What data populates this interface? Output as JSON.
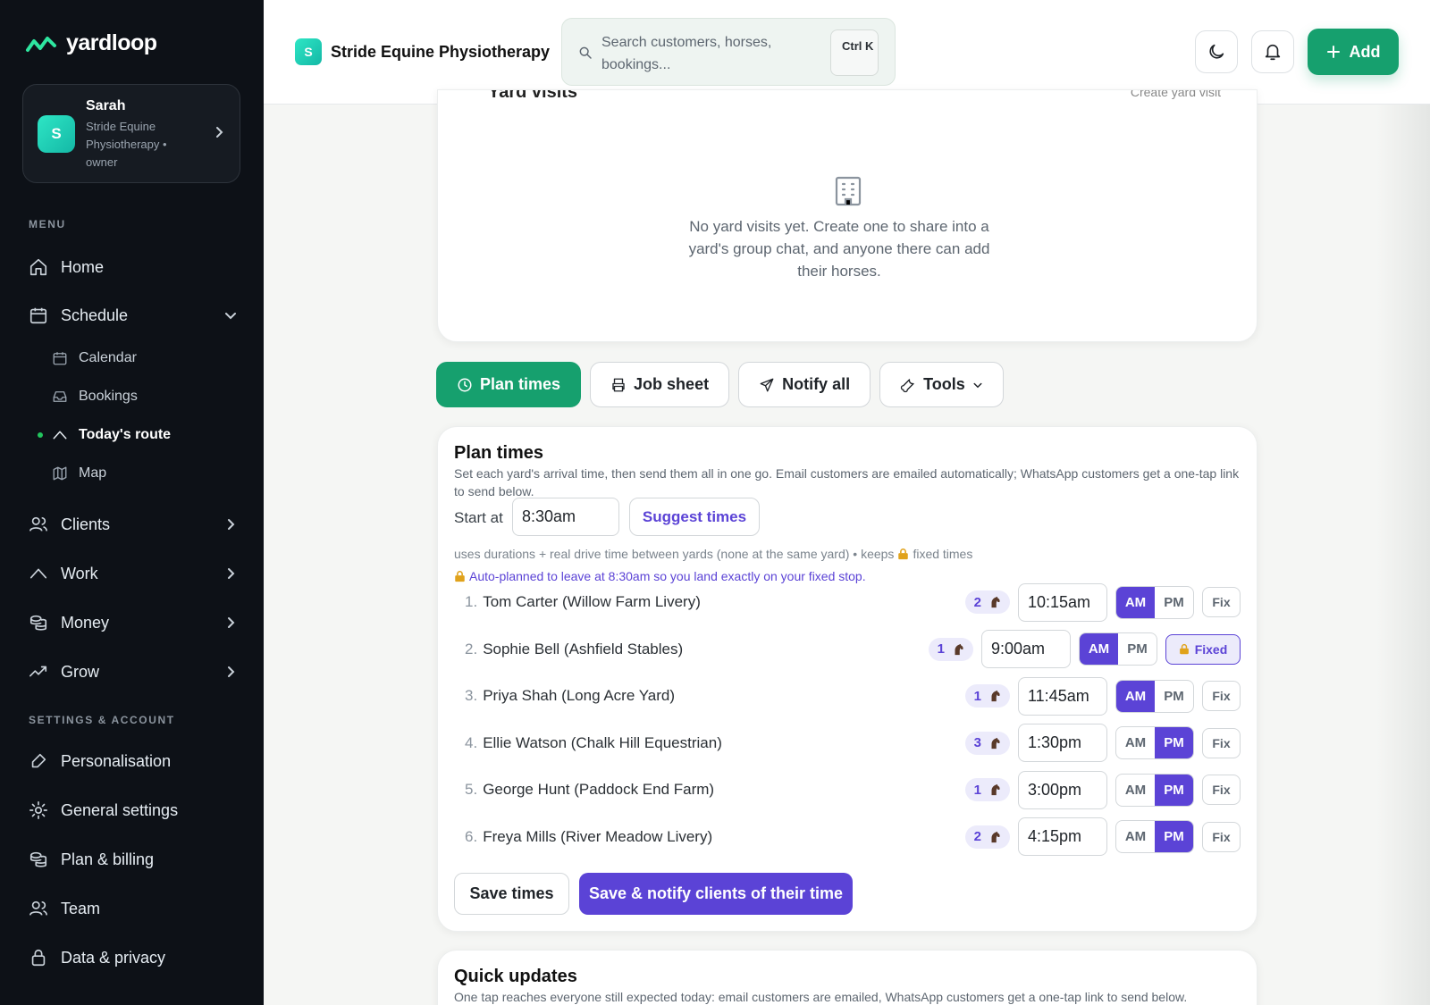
{
  "app": {
    "logo_text": "yardloop",
    "logo_icon": "yardloop-wave-icon"
  },
  "account": {
    "avatar_letter": "S",
    "name": "Sarah",
    "business": "Stride Equine Physiotherapy • owner"
  },
  "sidebar": {
    "menu_label": "MENU",
    "items": [
      {
        "label": "Home",
        "icon": "home-icon"
      },
      {
        "label": "Schedule",
        "icon": "calendar-icon"
      },
      {
        "label": "Clients",
        "icon": "users-icon"
      },
      {
        "label": "Work",
        "icon": "route-icon"
      },
      {
        "label": "Money",
        "icon": "coins-icon"
      },
      {
        "label": "Grow",
        "icon": "trend-icon"
      }
    ],
    "schedule_sub": [
      {
        "label": "Calendar",
        "icon": "calendar-icon"
      },
      {
        "label": "Bookings",
        "icon": "inbox-icon"
      },
      {
        "label": "Today's route",
        "icon": "route-icon",
        "active": true
      },
      {
        "label": "Map",
        "icon": "map-icon"
      }
    ],
    "settings_label": "SETTINGS & ACCOUNT",
    "settings_items": [
      {
        "label": "Personalisation",
        "icon": "brush-icon"
      },
      {
        "label": "General settings",
        "icon": "gear-icon"
      },
      {
        "label": "Plan & billing",
        "icon": "coins-icon"
      },
      {
        "label": "Team",
        "icon": "users-icon"
      },
      {
        "label": "Data & privacy",
        "icon": "lock-icon"
      }
    ]
  },
  "header": {
    "brand_letter": "S",
    "brand_name": "Stride Equine Physiotherapy",
    "search_placeholder": "Search customers, horses, bookings...",
    "shortcut": "Ctrl K",
    "add_label": "Add"
  },
  "yard_visits": {
    "title": "Yard visits",
    "link": "Create yard visit",
    "empty_text": "No yard visits yet. Create one to share into a yard's group chat, and anyone there can add their horses."
  },
  "actions": {
    "plan_times": "Plan times",
    "job_sheet": "Job sheet",
    "notify_all": "Notify all",
    "tools": "Tools"
  },
  "plan": {
    "title": "Plan times",
    "description": "Set each yard's arrival time, then send them all in one go. Email customers are emailed automatically; WhatsApp customers get a one-tap link to send below.",
    "start_label": "Start at",
    "start_value": "8:30am",
    "suggest_label": "Suggest times",
    "uses_note_a": "uses durations + real drive time between yards (none at the same yard) • keeps",
    "uses_note_b": "fixed times",
    "auto_note": "Auto-planned to leave at 8:30am so you land exactly on your fixed stop.",
    "am_label": "AM",
    "pm_label": "PM",
    "fix_label": "Fix",
    "fixed_label": "Fixed",
    "rows": [
      {
        "index": "1.",
        "label": "Tom Carter (Willow Farm Livery)",
        "horses": "2",
        "time": "10:15am",
        "period": "AM",
        "fixed": false
      },
      {
        "index": "2.",
        "label": "Sophie Bell (Ashfield Stables)",
        "horses": "1",
        "time": "9:00am",
        "period": "AM",
        "fixed": true
      },
      {
        "index": "3.",
        "label": "Priya Shah (Long Acre Yard)",
        "horses": "1",
        "time": "11:45am",
        "period": "AM",
        "fixed": false
      },
      {
        "index": "4.",
        "label": "Ellie Watson (Chalk Hill Equestrian)",
        "horses": "3",
        "time": "1:30pm",
        "period": "PM",
        "fixed": false
      },
      {
        "index": "5.",
        "label": "George Hunt (Paddock End Farm)",
        "horses": "1",
        "time": "3:00pm",
        "period": "PM",
        "fixed": false
      },
      {
        "index": "6.",
        "label": "Freya Mills (River Meadow Livery)",
        "horses": "2",
        "time": "4:15pm",
        "period": "PM",
        "fixed": false
      }
    ],
    "save_label": "Save times",
    "notify_label": "Save & notify clients of their time"
  },
  "quick": {
    "title": "Quick updates",
    "description": "One tap reaches everyone still expected today: email customers are emailed, WhatsApp customers get a one-tap link to send below."
  },
  "colors": {
    "brand_green": "#16a06e",
    "accent_purple": "#5b43d6",
    "sidebar_bg": "#0d1117"
  }
}
